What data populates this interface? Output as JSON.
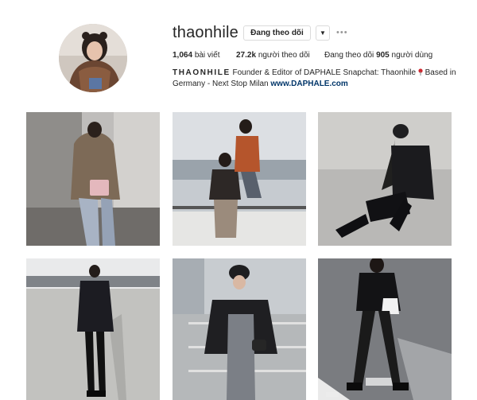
{
  "profile": {
    "username": "thaonhile",
    "follow_label": "Đang theo dõi",
    "dropdown_icon": "chevron-down-icon",
    "more_icon": "more-options-icon",
    "stats": {
      "posts_count": "1,064",
      "posts_label": "bài viết",
      "followers_count": "27.2k",
      "followers_label": "người theo dõi",
      "following_prefix": "Đang theo dõi",
      "following_count": "905",
      "following_suffix": "người dùng"
    },
    "bio": {
      "name": "THAONHILE",
      "text": "Founder & Editor of DAPHALE Snapchat: Thaonhile",
      "pin_icon": "location-pin-icon",
      "location": "Based in Germany - Next Stop Milan",
      "link": "www.DAPHALE.com"
    }
  },
  "posts": [
    {
      "label": "photo-1"
    },
    {
      "label": "photo-2"
    },
    {
      "label": "photo-3"
    },
    {
      "label": "photo-4"
    },
    {
      "label": "photo-5"
    },
    {
      "label": "photo-6"
    }
  ],
  "colors": {
    "link": "#003569",
    "border": "#dbdbdb",
    "text": "#262626"
  }
}
